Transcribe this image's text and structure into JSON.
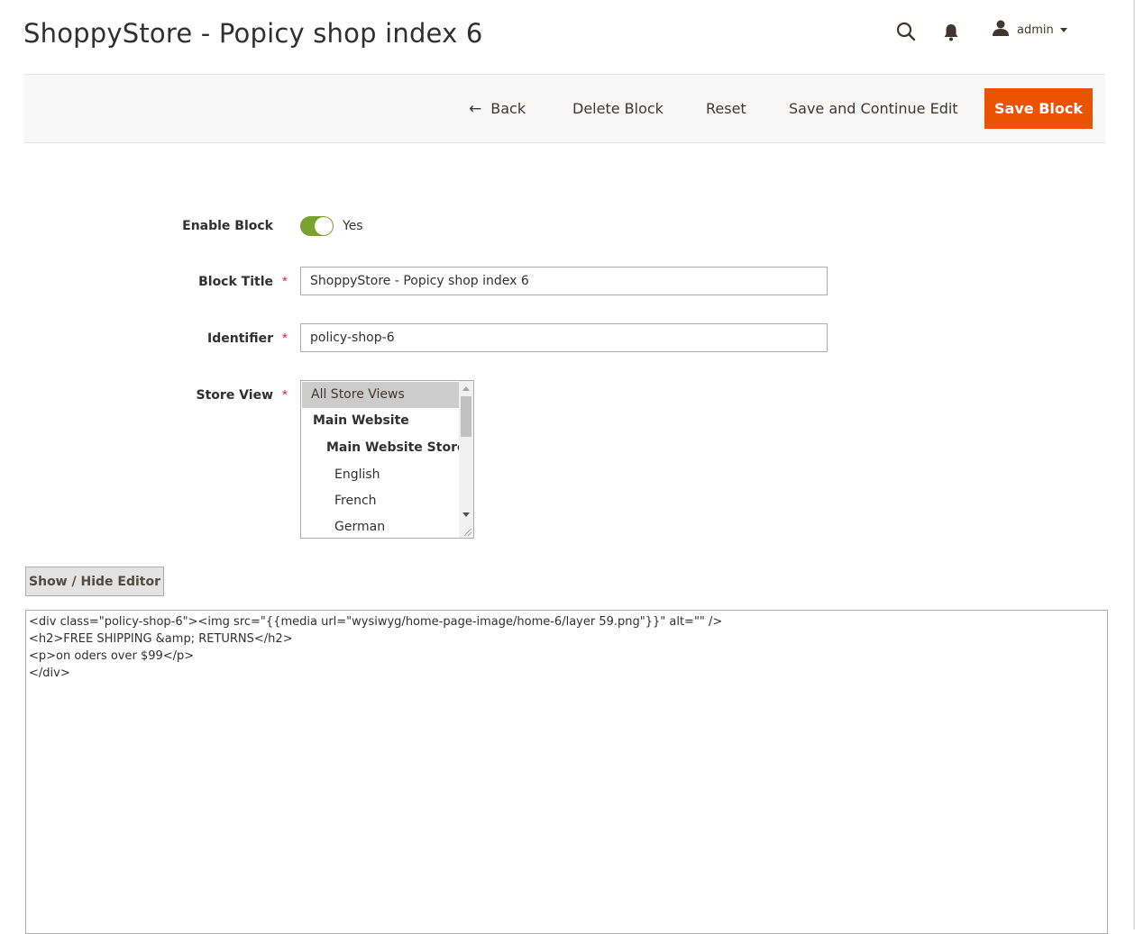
{
  "header": {
    "title": "ShoppyStore - Popicy shop index 6",
    "user_name": "admin",
    "icons": [
      "search-icon",
      "bell-icon",
      "user-icon"
    ]
  },
  "actions": {
    "back": "Back",
    "delete": "Delete Block",
    "reset": "Reset",
    "save_continue": "Save and Continue Edit",
    "save": "Save Block"
  },
  "form": {
    "enable": {
      "label": "Enable Block",
      "value_text": "Yes",
      "enabled": true
    },
    "title": {
      "label": "Block Title",
      "required_mark": "*",
      "value": "ShoppyStore - Popicy shop index 6"
    },
    "identifier": {
      "label": "Identifier",
      "required_mark": "*",
      "value": "policy-shop-6"
    },
    "store_view": {
      "label": "Store View",
      "required_mark": "*",
      "options": [
        {
          "label": "All Store Views",
          "selected": true
        },
        {
          "label": "Main Website",
          "group": true
        },
        {
          "label": "Main Website Store",
          "group": true
        },
        {
          "label": "English"
        },
        {
          "label": "French"
        },
        {
          "label": "German"
        }
      ]
    }
  },
  "editor": {
    "toggle_label": "Show / Hide Editor",
    "lines": [
      "<div class=\"policy-shop-6\"><img src=\"{{media url=\"wysiwyg/home-page-image/home-6/layer 59.png\"}}\" alt=\"\" />",
      "<h2>FREE SHIPPING &amp; RETURNS</h2>",
      "<p>on oders over $99</p>",
      "</div>"
    ]
  },
  "colors": {
    "primary_button": "#eb5202",
    "toggle_on": "#79a22e",
    "required": "#e22626"
  }
}
